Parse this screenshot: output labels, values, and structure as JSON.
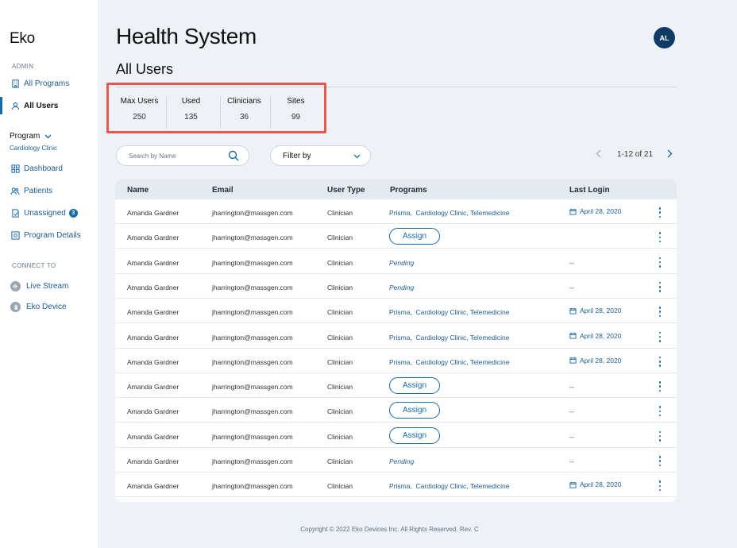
{
  "app": {
    "logo": "Eko"
  },
  "sidebar": {
    "admin_label": "ADMIN",
    "admin_items": [
      {
        "label": "All Programs",
        "icon": "building-icon"
      },
      {
        "label": "All Users",
        "icon": "user-icon",
        "active": true
      }
    ],
    "program": {
      "label": "Program",
      "name": "Cardiology Clinic"
    },
    "program_items": [
      {
        "label": "Dashboard",
        "icon": "grid-icon"
      },
      {
        "label": "Patients",
        "icon": "patients-icon"
      },
      {
        "label": "Unassigned",
        "icon": "unassigned-icon",
        "badge": "3"
      },
      {
        "label": "Program Details",
        "icon": "settings-icon"
      }
    ],
    "connect_label": "CONNECT TO",
    "connect_items": [
      {
        "label": "Live Stream",
        "icon": "stream-icon"
      },
      {
        "label": "Eko Device",
        "icon": "bluetooth-icon"
      }
    ]
  },
  "header": {
    "title": "Health System",
    "avatar": "AL"
  },
  "section_title": "All Users",
  "stats": [
    {
      "label": "Max Users",
      "value": "250"
    },
    {
      "label": "Used",
      "value": "135"
    },
    {
      "label": "Clinicians",
      "value": "36"
    },
    {
      "label": "Sites",
      "value": "99"
    }
  ],
  "search": {
    "placeholder": "Search by Name"
  },
  "filter": {
    "label": "Filter by"
  },
  "pagination": {
    "text": "1-12 of 21"
  },
  "table": {
    "columns": [
      "Name",
      "Email",
      "User Type",
      "Programs",
      "Last Login"
    ],
    "assign_label": "Assign",
    "rows": [
      {
        "name": "Amanda Gardner",
        "email": "jharrington@massgen.com",
        "type": "Clinician",
        "programs": "Prisma,  Cardiology Clinic, Telemedicine",
        "status": "programs",
        "last_login": "April 28, 2020"
      },
      {
        "name": "Amanda Gardner",
        "email": "jharrington@massgen.com",
        "type": "Clinician",
        "programs": "",
        "status": "assign",
        "last_login": ""
      },
      {
        "name": "Amanda Gardner",
        "email": "jharrington@massgen.com",
        "type": "Clinician",
        "programs": "Pending",
        "status": "pending",
        "last_login": "--"
      },
      {
        "name": "Amanda Gardner",
        "email": "jharrington@massgen.com",
        "type": "Clinician",
        "programs": "Pending",
        "status": "pending",
        "last_login": "--"
      },
      {
        "name": "Amanda Gardner",
        "email": "jharrington@massgen.com",
        "type": "Clinician",
        "programs": "Prisma,  Cardiology Clinic, Telemedicine",
        "status": "programs",
        "last_login": "April 28, 2020"
      },
      {
        "name": "Amanda Gardner",
        "email": "jharrington@massgen.com",
        "type": "Clinician",
        "programs": "Prisma,  Cardiology Clinic, Telemedicine",
        "status": "programs",
        "last_login": "April 28, 2020"
      },
      {
        "name": "Amanda Gardner",
        "email": "jharrington@massgen.com",
        "type": "Clinician",
        "programs": "Prisma,  Cardiology Clinic, Telemedicine",
        "status": "programs",
        "last_login": "April 28, 2020"
      },
      {
        "name": "Amanda Gardner",
        "email": "jharrington@massgen.com",
        "type": "Clinician",
        "programs": "",
        "status": "assign",
        "last_login": "--"
      },
      {
        "name": "Amanda Gardner",
        "email": "jharrington@massgen.com",
        "type": "Clinician",
        "programs": "",
        "status": "assign",
        "last_login": "--"
      },
      {
        "name": "Amanda Gardner",
        "email": "jharrington@massgen.com",
        "type": "Clinician",
        "programs": "",
        "status": "assign",
        "last_login": "--"
      },
      {
        "name": "Amanda Gardner",
        "email": "jharrington@massgen.com",
        "type": "Clinician",
        "programs": "Pending",
        "status": "pending",
        "last_login": "--"
      },
      {
        "name": "Amanda Gardner",
        "email": "jharrington@massgen.com",
        "type": "Clinician",
        "programs": "Prisma,  Cardiology Clinic, Telemedicine",
        "status": "programs",
        "last_login": "April 28, 2020"
      }
    ]
  },
  "footer": "Copyright © 2022 Eko Devices Inc. All Rights Reserved. Rev. C",
  "colors": {
    "accent": "#1a6aa8",
    "highlight": "#e8574d",
    "avatar": "#0f3b66"
  }
}
